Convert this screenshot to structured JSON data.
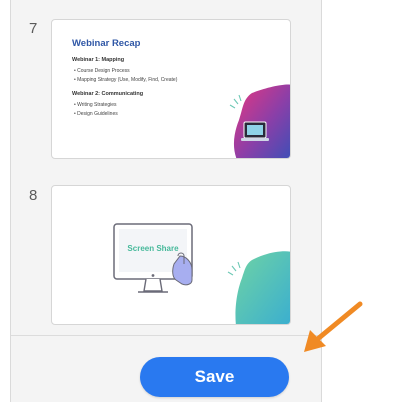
{
  "slides": [
    {
      "number": "7",
      "title": "Webinar Recap",
      "sections": [
        {
          "heading": "Webinar 1: Mapping",
          "bullets": [
            "Course Design Process",
            "Mapping Strategy (Use, Modify, Find, Create)"
          ]
        },
        {
          "heading": "Webinar 2: Communicating",
          "bullets": [
            "Writing Strategies",
            "Design Guidelines"
          ]
        }
      ]
    },
    {
      "number": "8",
      "screen_label": "Screen Share"
    }
  ],
  "save_button": {
    "label": "Save"
  },
  "colors": {
    "accent": "#2979f0",
    "arrow": "#f08a24",
    "slide_title": "#2f57a6"
  }
}
